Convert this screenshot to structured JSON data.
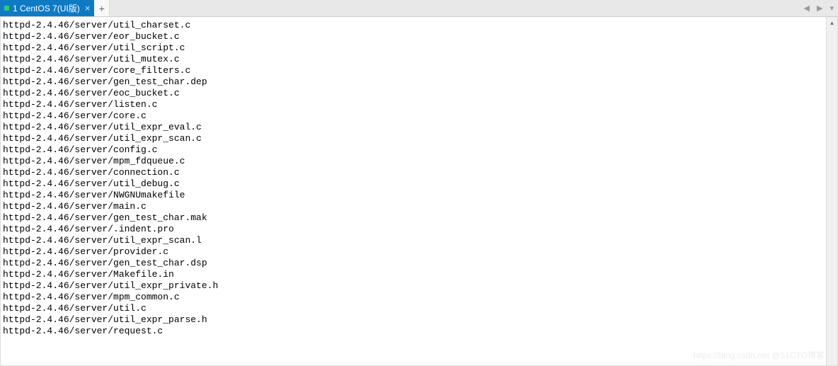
{
  "tab": {
    "label": "1 CentOS 7(UI版)",
    "close_glyph": "×"
  },
  "add_tab_glyph": "+",
  "nav": {
    "left": "◀",
    "right": "▶",
    "menu": "▾"
  },
  "scrollbar": {
    "up": "▴"
  },
  "watermark": "https://blog.csdn.net @51CTO博客",
  "terminal_lines": [
    "httpd-2.4.46/server/util_charset.c",
    "httpd-2.4.46/server/eor_bucket.c",
    "httpd-2.4.46/server/util_script.c",
    "httpd-2.4.46/server/util_mutex.c",
    "httpd-2.4.46/server/core_filters.c",
    "httpd-2.4.46/server/gen_test_char.dep",
    "httpd-2.4.46/server/eoc_bucket.c",
    "httpd-2.4.46/server/listen.c",
    "httpd-2.4.46/server/core.c",
    "httpd-2.4.46/server/util_expr_eval.c",
    "httpd-2.4.46/server/util_expr_scan.c",
    "httpd-2.4.46/server/config.c",
    "httpd-2.4.46/server/mpm_fdqueue.c",
    "httpd-2.4.46/server/connection.c",
    "httpd-2.4.46/server/util_debug.c",
    "httpd-2.4.46/server/NWGNUmakefile",
    "httpd-2.4.46/server/main.c",
    "httpd-2.4.46/server/gen_test_char.mak",
    "httpd-2.4.46/server/.indent.pro",
    "httpd-2.4.46/server/util_expr_scan.l",
    "httpd-2.4.46/server/provider.c",
    "httpd-2.4.46/server/gen_test_char.dsp",
    "httpd-2.4.46/server/Makefile.in",
    "httpd-2.4.46/server/util_expr_private.h",
    "httpd-2.4.46/server/mpm_common.c",
    "httpd-2.4.46/server/util.c",
    "httpd-2.4.46/server/util_expr_parse.h",
    "httpd-2.4.46/server/request.c"
  ]
}
